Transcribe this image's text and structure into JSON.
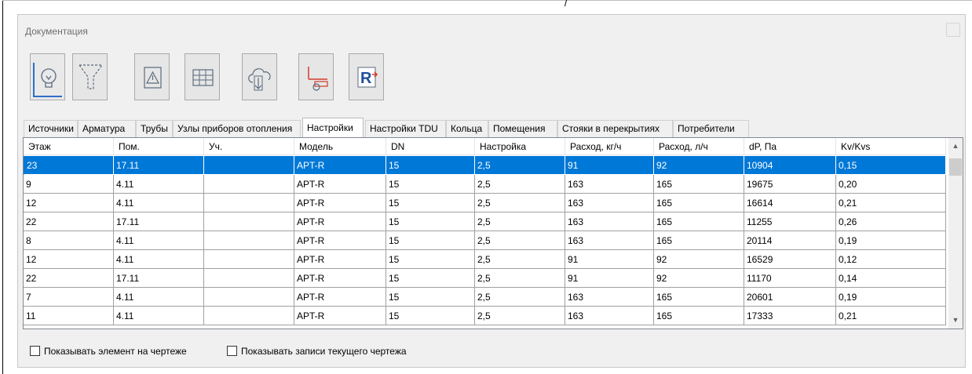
{
  "window": {
    "title": "Документация"
  },
  "toolbar": {
    "buttons": [
      {
        "name": "lightbulb"
      },
      {
        "name": "filter"
      },
      {
        "name": "warning"
      },
      {
        "name": "table"
      },
      {
        "name": "cloud-download"
      },
      {
        "name": "pipe-connection"
      },
      {
        "name": "revit-export"
      }
    ]
  },
  "tabs": [
    {
      "label": "Источники"
    },
    {
      "label": "Арматура"
    },
    {
      "label": "Трубы"
    },
    {
      "label": "Узлы приборов отопления"
    },
    {
      "label": "Настройки",
      "active": true
    },
    {
      "label": "Настройки TDU"
    },
    {
      "label": "Кольца"
    },
    {
      "label": "Помещения"
    },
    {
      "label": "Стояки в перекрытиях"
    },
    {
      "label": "Потребители"
    }
  ],
  "grid": {
    "columns": [
      "Этаж",
      "Пом.",
      "Уч.",
      "Модель",
      "DN",
      "Настройка",
      "Расход, кг/ч",
      "Расход, л/ч",
      "dP, Па",
      "Kv/Kvs"
    ],
    "rows": [
      [
        "23",
        "17.11",
        "",
        "APT-R",
        "15",
        "2,5",
        "91",
        "92",
        "10904",
        "0,15"
      ],
      [
        "9",
        "4.11",
        "",
        "APT-R",
        "15",
        "2,5",
        "163",
        "165",
        "19675",
        "0,20"
      ],
      [
        "12",
        "4.11",
        "",
        "APT-R",
        "15",
        "2,5",
        "163",
        "165",
        "16614",
        "0,21"
      ],
      [
        "22",
        "17.11",
        "",
        "APT-R",
        "15",
        "2,5",
        "163",
        "165",
        "11255",
        "0,26"
      ],
      [
        "8",
        "4.11",
        "",
        "APT-R",
        "15",
        "2,5",
        "163",
        "165",
        "20114",
        "0,19"
      ],
      [
        "12",
        "4.11",
        "",
        "APT-R",
        "15",
        "2,5",
        "91",
        "92",
        "16529",
        "0,12"
      ],
      [
        "22",
        "17.11",
        "",
        "APT-R",
        "15",
        "2,5",
        "91",
        "92",
        "11170",
        "0,14"
      ],
      [
        "7",
        "4.11",
        "",
        "APT-R",
        "15",
        "2,5",
        "163",
        "165",
        "20601",
        "0,19"
      ],
      [
        "11",
        "4.11",
        "",
        "APT-R",
        "15",
        "2,5",
        "163",
        "165",
        "17333",
        "0,21"
      ]
    ],
    "selected_row": 0
  },
  "options": {
    "show_element": "Показывать элемент на чертеже",
    "show_current_records": "Показывать записи текущего чертежа"
  },
  "colors": {
    "selection": "#0078d7",
    "accent": "#2e6ec9"
  }
}
